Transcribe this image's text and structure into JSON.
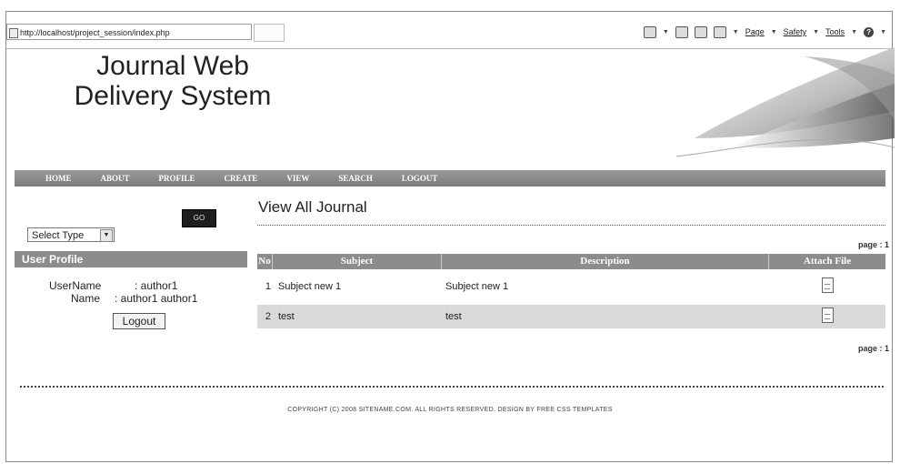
{
  "browser": {
    "address": "http://localhost/project_session/index.php",
    "menus": [
      "Page",
      "Safety",
      "Tools"
    ]
  },
  "site": {
    "title_line1": "Journal Web",
    "title_line2": "Delivery System"
  },
  "nav": [
    "HOME",
    "ABOUT",
    "PROFILE",
    "CREATE",
    "VIEW",
    "SEARCH",
    "LOGOUT"
  ],
  "sidebar": {
    "go_label": "GO",
    "select_value": "Select Type",
    "profile_heading": "User Profile",
    "username_label": "UserName",
    "username_value": ": author1",
    "name_label": "Name",
    "name_value": ": author1 author1",
    "logout_label": "Logout"
  },
  "main": {
    "title": "View All Journal",
    "page_top": "page : 1",
    "page_bottom": "page : 1",
    "columns": [
      "No",
      "Subject",
      "Description",
      "Attach File"
    ],
    "rows": [
      {
        "no": "1",
        "subject": "Subject new 1",
        "description": "Subject new 1"
      },
      {
        "no": "2",
        "subject": "test",
        "description": "test"
      }
    ]
  },
  "footer": "COPYRIGHT (C) 2008 SITENAME.COM. ALL RIGHTS RESERVED. DESIGN BY FREE CSS TEMPLATES"
}
